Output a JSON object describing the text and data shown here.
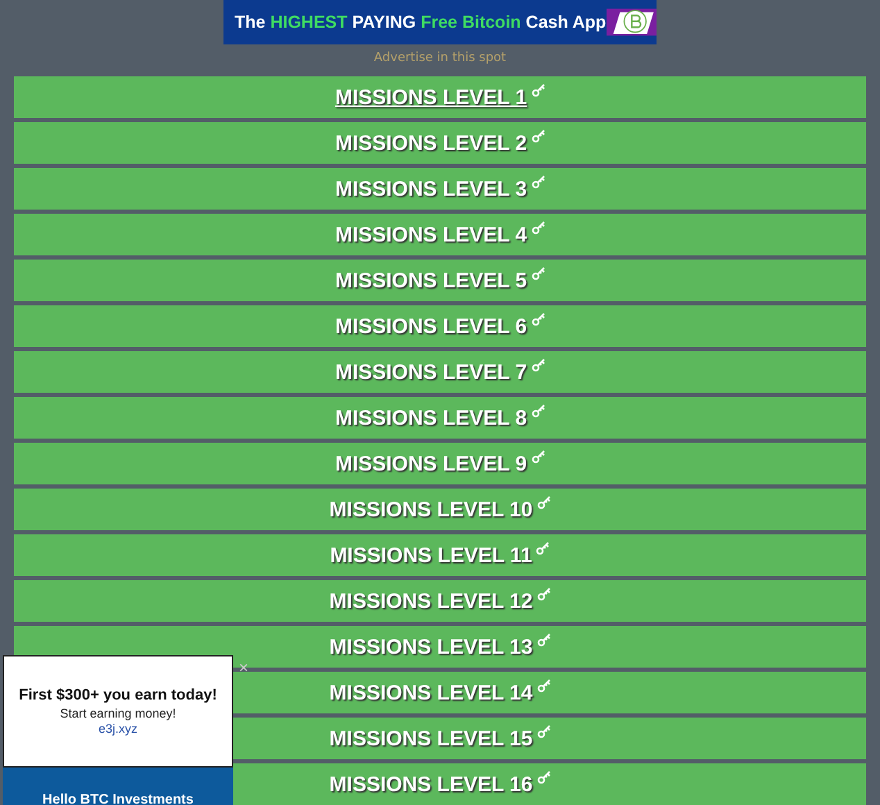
{
  "banner": {
    "segments": [
      {
        "text": "The ",
        "kind": "plain"
      },
      {
        "text": "HIGHEST",
        "kind": "highlight"
      },
      {
        "text": " PAYING ",
        "kind": "plain"
      },
      {
        "text": "Free Bitcoin",
        "kind": "highlight"
      },
      {
        "text": " Cash App",
        "kind": "plain"
      }
    ]
  },
  "advertise_link": "Advertise in this spot",
  "missions": [
    {
      "label": "MISSIONS LEVEL 1",
      "hovered": true
    },
    {
      "label": "MISSIONS LEVEL 2",
      "hovered": false
    },
    {
      "label": "MISSIONS LEVEL 3",
      "hovered": false
    },
    {
      "label": "MISSIONS LEVEL 4",
      "hovered": false
    },
    {
      "label": "MISSIONS LEVEL 5",
      "hovered": false
    },
    {
      "label": "MISSIONS LEVEL 6",
      "hovered": false
    },
    {
      "label": "MISSIONS LEVEL 7",
      "hovered": false
    },
    {
      "label": "MISSIONS LEVEL 8",
      "hovered": false
    },
    {
      "label": "MISSIONS LEVEL 9",
      "hovered": false
    },
    {
      "label": "MISSIONS LEVEL 10",
      "hovered": false
    },
    {
      "label": "MISSIONS LEVEL 11",
      "hovered": false
    },
    {
      "label": "MISSIONS LEVEL 12",
      "hovered": false
    },
    {
      "label": "MISSIONS LEVEL 13",
      "hovered": false
    },
    {
      "label": "MISSIONS LEVEL 14",
      "hovered": false
    },
    {
      "label": "MISSIONS LEVEL 15",
      "hovered": false
    },
    {
      "label": "MISSIONS LEVEL 16",
      "hovered": false
    }
  ],
  "popup_ad": {
    "headline": "First $300+ you earn today!",
    "subline": "Start earning money!",
    "domain": "e3j.xyz",
    "close": "×",
    "second_ad": "Hello BTC Investments"
  }
}
